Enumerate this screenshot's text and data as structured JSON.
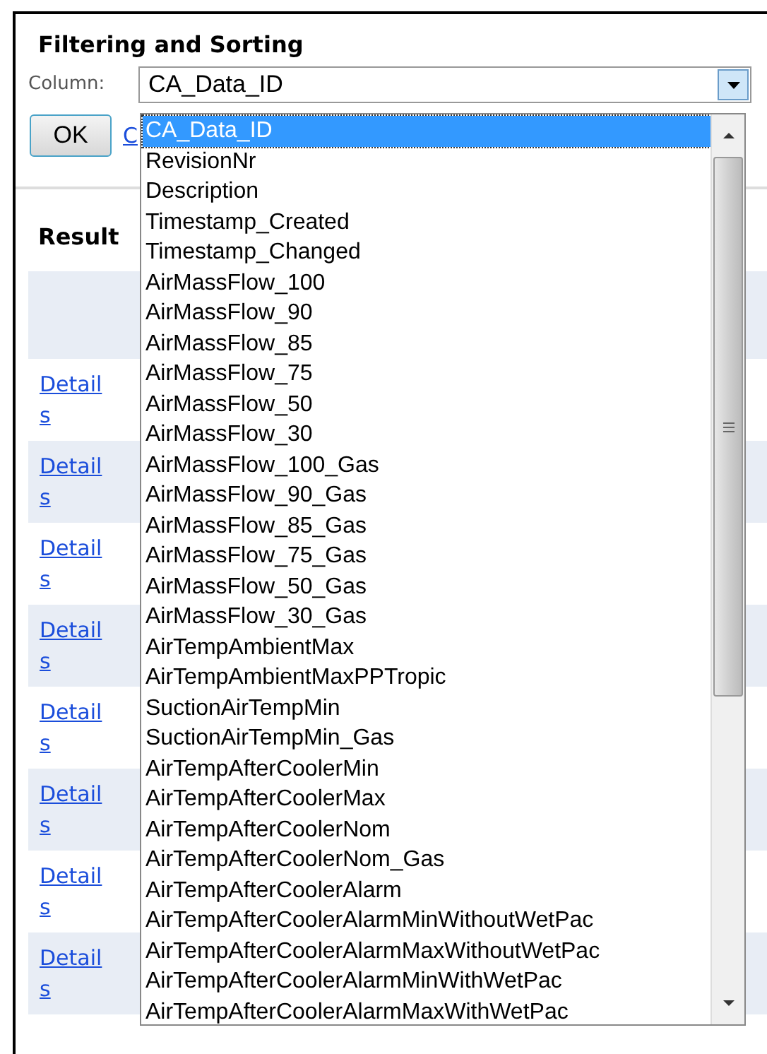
{
  "title": "Filtering and Sorting",
  "column_select": {
    "label": "Column:",
    "value": "CA_Data_ID",
    "expanded": true
  },
  "ok_button": "OK",
  "link": "C",
  "results_heading": "Result",
  "table": {
    "rows": [
      {
        "link": "Details"
      },
      {
        "link": "Details"
      },
      {
        "link": "Details"
      },
      {
        "link": "Details"
      },
      {
        "link": "Details"
      },
      {
        "link": "Details"
      },
      {
        "link": "Details"
      },
      {
        "link": "Details"
      }
    ]
  },
  "dropdown_options": [
    {
      "label": "CA_Data_ID",
      "selected": true
    },
    {
      "label": "RevisionNr",
      "selected": false
    },
    {
      "label": "Description",
      "selected": false
    },
    {
      "label": "Timestamp_Created",
      "selected": false
    },
    {
      "label": "Timestamp_Changed",
      "selected": false
    },
    {
      "label": "AirMassFlow_100",
      "selected": false
    },
    {
      "label": "AirMassFlow_90",
      "selected": false
    },
    {
      "label": "AirMassFlow_85",
      "selected": false
    },
    {
      "label": "AirMassFlow_75",
      "selected": false
    },
    {
      "label": "AirMassFlow_50",
      "selected": false
    },
    {
      "label": "AirMassFlow_30",
      "selected": false
    },
    {
      "label": "AirMassFlow_100_Gas",
      "selected": false
    },
    {
      "label": "AirMassFlow_90_Gas",
      "selected": false
    },
    {
      "label": "AirMassFlow_85_Gas",
      "selected": false
    },
    {
      "label": "AirMassFlow_75_Gas",
      "selected": false
    },
    {
      "label": "AirMassFlow_50_Gas",
      "selected": false
    },
    {
      "label": "AirMassFlow_30_Gas",
      "selected": false
    },
    {
      "label": "AirTempAmbientMax",
      "selected": false
    },
    {
      "label": "AirTempAmbientMaxPPTropic",
      "selected": false
    },
    {
      "label": "SuctionAirTempMin",
      "selected": false
    },
    {
      "label": "SuctionAirTempMin_Gas",
      "selected": false
    },
    {
      "label": "AirTempAfterCoolerMin",
      "selected": false
    },
    {
      "label": "AirTempAfterCoolerMax",
      "selected": false
    },
    {
      "label": "AirTempAfterCoolerNom",
      "selected": false
    },
    {
      "label": "AirTempAfterCoolerNom_Gas",
      "selected": false
    },
    {
      "label": "AirTempAfterCoolerAlarm",
      "selected": false
    },
    {
      "label": "AirTempAfterCoolerAlarmMinWithoutWetPac",
      "selected": false
    },
    {
      "label": "AirTempAfterCoolerAlarmMaxWithoutWetPac",
      "selected": false
    },
    {
      "label": "AirTempAfterCoolerAlarmMinWithWetPac",
      "selected": false
    },
    {
      "label": "AirTempAfterCoolerAlarmMaxWithWetPac",
      "selected": false
    }
  ]
}
